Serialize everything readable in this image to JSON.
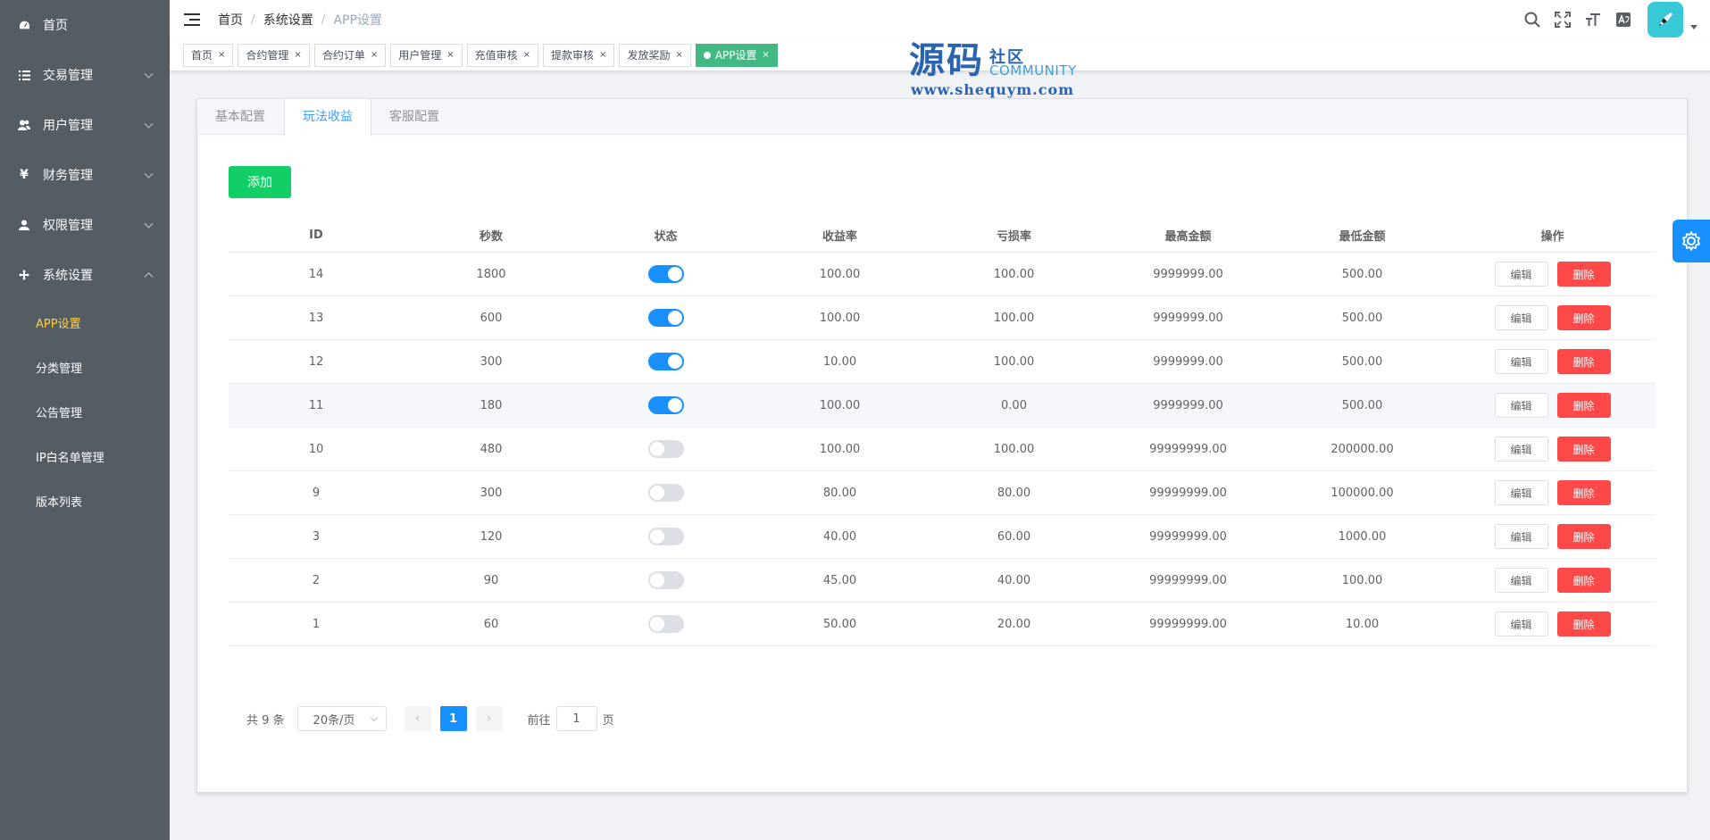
{
  "sidebar": {
    "items": [
      {
        "label": "首页",
        "icon": "dashboard-icon"
      },
      {
        "label": "交易管理",
        "icon": "list-icon"
      },
      {
        "label": "用户管理",
        "icon": "users-icon"
      },
      {
        "label": "财务管理",
        "icon": "yen-icon"
      },
      {
        "label": "权限管理",
        "icon": "user-icon"
      },
      {
        "label": "系统设置",
        "icon": "move-icon"
      }
    ],
    "sub_items": [
      "APP设置",
      "分类管理",
      "公告管理",
      "IP白名单管理",
      "版本列表"
    ]
  },
  "header": {
    "breadcrumb": [
      "首页",
      "系统设置",
      "APP设置"
    ],
    "breadcrumb_sep": "/"
  },
  "tags": [
    {
      "label": "首页"
    },
    {
      "label": "合约管理"
    },
    {
      "label": "合约订单"
    },
    {
      "label": "用户管理"
    },
    {
      "label": "充值审核"
    },
    {
      "label": "提款审核"
    },
    {
      "label": "发放奖励"
    },
    {
      "label": "APP设置"
    }
  ],
  "tag_close": "×",
  "watermark": {
    "big": "源码",
    "cn": "社区",
    "en": "COMMUNITY",
    "url": "www.shequym.com"
  },
  "tabs": [
    "基本配置",
    "玩法收益",
    "客服配置"
  ],
  "add_label": "添加",
  "table": {
    "columns": [
      "ID",
      "秒数",
      "状态",
      "收益率",
      "亏损率",
      "最高金额",
      "最低金额",
      "操作"
    ],
    "edit_label": "编辑",
    "delete_label": "删除",
    "rows": [
      {
        "id": "14",
        "sec": "1800",
        "on": true,
        "rate": "100.00",
        "loss": "100.00",
        "max": "9999999.00",
        "min": "500.00"
      },
      {
        "id": "13",
        "sec": "600",
        "on": true,
        "rate": "100.00",
        "loss": "100.00",
        "max": "9999999.00",
        "min": "500.00"
      },
      {
        "id": "12",
        "sec": "300",
        "on": true,
        "rate": "10.00",
        "loss": "100.00",
        "max": "9999999.00",
        "min": "500.00"
      },
      {
        "id": "11",
        "sec": "180",
        "on": true,
        "rate": "100.00",
        "loss": "0.00",
        "max": "9999999.00",
        "min": "500.00"
      },
      {
        "id": "10",
        "sec": "480",
        "on": false,
        "rate": "100.00",
        "loss": "100.00",
        "max": "99999999.00",
        "min": "200000.00"
      },
      {
        "id": "9",
        "sec": "300",
        "on": false,
        "rate": "80.00",
        "loss": "80.00",
        "max": "99999999.00",
        "min": "100000.00"
      },
      {
        "id": "3",
        "sec": "120",
        "on": false,
        "rate": "40.00",
        "loss": "60.00",
        "max": "99999999.00",
        "min": "1000.00"
      },
      {
        "id": "2",
        "sec": "90",
        "on": false,
        "rate": "45.00",
        "loss": "40.00",
        "max": "99999999.00",
        "min": "100.00"
      },
      {
        "id": "1",
        "sec": "60",
        "on": false,
        "rate": "50.00",
        "loss": "20.00",
        "max": "99999999.00",
        "min": "10.00"
      }
    ]
  },
  "pagination": {
    "total": "共 9 条",
    "page_size": "20条/页",
    "prev": "‹",
    "next": "›",
    "current": "1",
    "goto_label": "前往",
    "goto_value": "1",
    "goto_suffix": "页"
  },
  "colors": {
    "sidebar_bg": "#545c64",
    "active_menu": "#ffd04b",
    "primary": "#1890ff",
    "success": "#13ce66",
    "danger": "#ff4949",
    "tag_active": "#42b983"
  }
}
